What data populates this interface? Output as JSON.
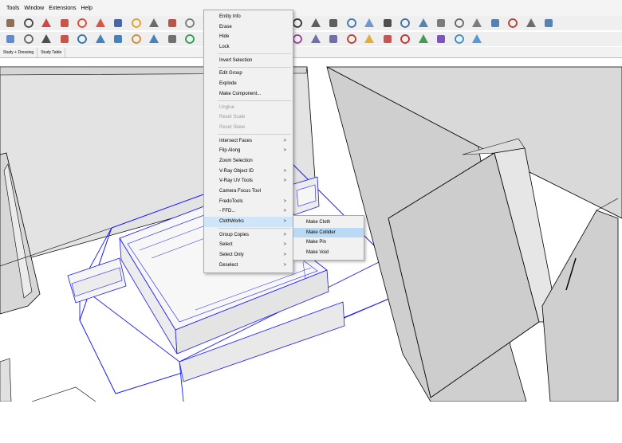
{
  "menubar": [
    "Tools",
    "Window",
    "Extensions",
    "Help"
  ],
  "scene_tabs": [
    "Study + Dressing",
    "Study Table"
  ],
  "context_menu": {
    "groups": [
      [
        {
          "label": "Entity Info",
          "submenu": false,
          "disabled": false
        },
        {
          "label": "Erase",
          "submenu": false,
          "disabled": false
        },
        {
          "label": "Hide",
          "submenu": false,
          "disabled": false
        },
        {
          "label": "Lock",
          "submenu": false,
          "disabled": false
        }
      ],
      [
        {
          "label": "Invert Selection",
          "submenu": false,
          "disabled": false
        }
      ],
      [
        {
          "label": "Edit Group",
          "submenu": false,
          "disabled": false
        },
        {
          "label": "Explode",
          "submenu": false,
          "disabled": false
        },
        {
          "label": "Make Component...",
          "submenu": false,
          "disabled": false
        }
      ],
      [
        {
          "label": "Unglue",
          "submenu": false,
          "disabled": true
        },
        {
          "label": "Reset Scale",
          "submenu": false,
          "disabled": true
        },
        {
          "label": "Reset Skew",
          "submenu": false,
          "disabled": true
        }
      ],
      [
        {
          "label": "Intersect Faces",
          "submenu": true,
          "disabled": false
        },
        {
          "label": "Flip Along",
          "submenu": true,
          "disabled": false
        },
        {
          "label": "Zoom Selection",
          "submenu": false,
          "disabled": false
        },
        {
          "label": "V-Ray Object ID",
          "submenu": true,
          "disabled": false
        },
        {
          "label": "V-Ray UV Tools",
          "submenu": true,
          "disabled": false
        },
        {
          "label": "Camera Focus Tool",
          "submenu": false,
          "disabled": false
        },
        {
          "label": "FredoTools",
          "submenu": true,
          "disabled": false
        },
        {
          "label": "- FFD...",
          "submenu": true,
          "disabled": false
        },
        {
          "label": "ClothWorks",
          "submenu": true,
          "disabled": false,
          "active": true
        }
      ],
      [
        {
          "label": "Group Copies",
          "submenu": true,
          "disabled": false
        },
        {
          "label": "Select",
          "submenu": true,
          "disabled": false
        },
        {
          "label": "Select Only",
          "submenu": true,
          "disabled": false
        },
        {
          "label": "Deselect",
          "submenu": true,
          "disabled": false
        }
      ]
    ],
    "arrow": ">"
  },
  "clothworks_submenu": [
    {
      "label": "Make Cloth",
      "highlighted": false
    },
    {
      "label": "Make Collider",
      "highlighted": true
    },
    {
      "label": "Make Pin",
      "highlighted": false
    },
    {
      "label": "Make Void",
      "highlighted": false
    }
  ],
  "toolbar_icons": {
    "row1": [
      "paint-bucket-icon",
      "dropdown-arrow-icon",
      "push-pull-icon",
      "sandbox-icon",
      "move-icon",
      "rotate-icon",
      "scale-icon",
      "tape-icon",
      "text-icon",
      "paint-icon",
      "follow-me-icon",
      "offset-icon",
      "person-icon",
      "dropdown-arrow-icon",
      "circle-icon",
      "teapot-icon",
      "teapot-icon",
      "cloud-icon",
      "section-icon",
      "section-icon",
      "xray-icon",
      "wireframe-icon",
      "hidden-line-icon",
      "shaded-icon",
      "textured-icon",
      "view-icon",
      "view-icon",
      "box-icon",
      "box-icon",
      "box-icon",
      "box-icon"
    ],
    "row2": [
      "orbit-icon",
      "pan-icon",
      "walk-icon",
      "look-icon",
      "render-icon",
      "render-icon",
      "render-icon",
      "light-icon",
      "camera-icon",
      "material-icon",
      "component-icon",
      "sun-icon",
      "star-icon",
      "tools-icon",
      "sphere-icon",
      "sphere-icon",
      "sphere-icon",
      "ruler-icon",
      "fx-icon",
      "grid-icon",
      "grid-icon",
      "gear-icon",
      "grid-icon",
      "leaves-icon",
      "toggle-icon",
      "toggle-icon",
      "cycle-icon"
    ],
    "row1_colors": [
      "#7a5a3a",
      "#444444",
      "#cc2a2a",
      "#c0392b",
      "#e0452a",
      "#d33b2a",
      "#2a4f9e",
      "#e0a020",
      "#555555",
      "#b03a2e",
      "#7a7a7a",
      "#cc4a2a",
      "#c0392b",
      "#e07a2a",
      "#2a7fc4",
      "#444444",
      "#333333",
      "#444444",
      "#444444",
      "#3a74b8",
      "#5a86c6",
      "#333333",
      "#3a6ea5",
      "#3a6ea5",
      "#666666",
      "#666666",
      "#666666",
      "#3a6ea5",
      "#c0392b",
      "#555555",
      "#3a6ea5",
      "#555555",
      "#555555",
      "#555555",
      "#555555"
    ],
    "row2_colors": [
      "#4a78c2",
      "#666666",
      "#333333",
      "#c0392b",
      "#2a6fb0",
      "#2a6fb0",
      "#2a6fb0",
      "#d08a2a",
      "#2a6fb0",
      "#5a5a5a",
      "#2a9a4a",
      "#d44c2a",
      "#e08a20",
      "#2a8a3a",
      "#666666",
      "#e0a020",
      "#9a3aa0",
      "#5a5a9a",
      "#5a5a9a",
      "#c0392b",
      "#e0a020",
      "#c03a3a",
      "#cc2a2a",
      "#2a8a3a",
      "#6a3ab0",
      "#3a8ad0",
      "#3a8ad0",
      "#3a8ad0"
    ]
  }
}
